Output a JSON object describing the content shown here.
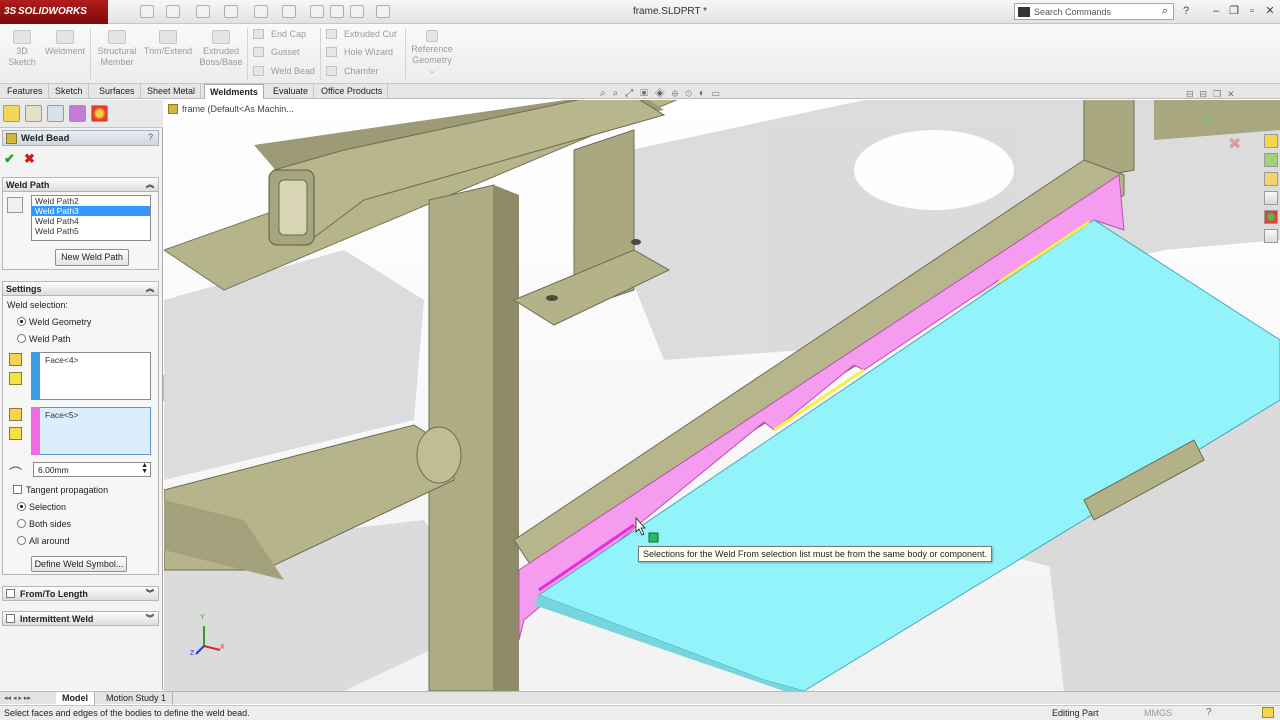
{
  "app": {
    "logo_text": "SOLIDWORKS",
    "document_title": "frame.SLDPRT *"
  },
  "search": {
    "placeholder": "Search Commands"
  },
  "ribbon": {
    "big_buttons": [
      {
        "label": "3D Sketch"
      },
      {
        "label": "Weldment"
      },
      {
        "label": "Structural Member"
      },
      {
        "label": "Trim/Extend"
      },
      {
        "label": "Extruded Boss/Base"
      }
    ],
    "small_col1": [
      "End Cap",
      "Gusset",
      "Weld Bead"
    ],
    "small_col2": [
      "Extruded Cut",
      "Hole Wizard",
      "Chamfer"
    ],
    "reference_geometry": "Reference Geometry"
  },
  "tabs": [
    "Features",
    "Sketch",
    "Surfaces",
    "Sheet Metal",
    "Weldments",
    "Evaluate",
    "Office Products"
  ],
  "active_tab": "Weldments",
  "property_manager": {
    "title": "Weld Bead",
    "help": "?",
    "weld_path": {
      "header": "Weld Path",
      "items": [
        "Weld Path2",
        "Weld Path3",
        "Weld Path4",
        "Weld Path5"
      ],
      "selected_item": "Weld Path3",
      "new_button": "New Weld Path"
    },
    "settings": {
      "header": "Settings",
      "weld_selection_label": "Weld selection:",
      "options": [
        "Weld Geometry",
        "Weld Path"
      ],
      "selected_option": "Weld Geometry",
      "face_from": "Face<4>",
      "face_to": "Face<5>",
      "bead_size": "6.00mm",
      "tangent_propagation": "Tangent propagation",
      "extent_options": [
        "Selection",
        "Both sides",
        "All around"
      ],
      "selected_extent": "Selection",
      "define_symbol_button": "Define Weld Symbol..."
    },
    "from_to_length": "From/To Length",
    "intermittent_weld": "Intermittent Weld"
  },
  "viewport": {
    "breadcrumb": "frame  (Default<As Machin...",
    "tooltip": "Selections for the Weld From selection list must be from the same body or component.",
    "triad_labels": {
      "x": "X",
      "y": "Y",
      "z": "Z"
    }
  },
  "bottom_tabs": [
    "Model",
    "Motion Study 1"
  ],
  "active_bottom_tab": "Model",
  "status": {
    "message": "Select faces and edges of the bodies to define the weld bead.",
    "mode": "Editing Part",
    "units": "MMGS"
  },
  "colors": {
    "accent_magenta": "#f59cf0",
    "accent_cyan": "#93f3fb",
    "steel": "#bab890",
    "selection_blue": "#3399ff"
  }
}
